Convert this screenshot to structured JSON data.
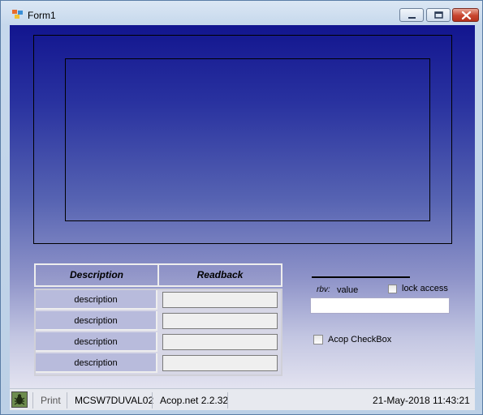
{
  "window": {
    "title": "Form1",
    "icons": [
      "app-icon",
      "minimize-icon",
      "maximize-icon",
      "close-icon"
    ]
  },
  "readback_table": {
    "headers": [
      "Description",
      "Readback"
    ],
    "rows": [
      {
        "description": "description",
        "readback": ""
      },
      {
        "description": "description",
        "readback": ""
      },
      {
        "description": "description",
        "readback": ""
      },
      {
        "description": "description",
        "readback": ""
      }
    ]
  },
  "rbv": {
    "label": "rbv:",
    "value_label": "value",
    "input_value": "",
    "lock_access_label": "lock access",
    "lock_access_checked": false
  },
  "acop_checkbox": {
    "label": "Acop CheckBox",
    "checked": false
  },
  "status_bar": {
    "icon": "bug-icon",
    "print_label": "Print",
    "host": "MCSW7DUVAL02",
    "version": "Acop.net 2.2.32",
    "datetime": "21-May-2018 11:43:21"
  },
  "colors": {
    "client_top": "#12158f",
    "client_bottom": "#e3e3f0",
    "close_button": "#c8452f"
  }
}
